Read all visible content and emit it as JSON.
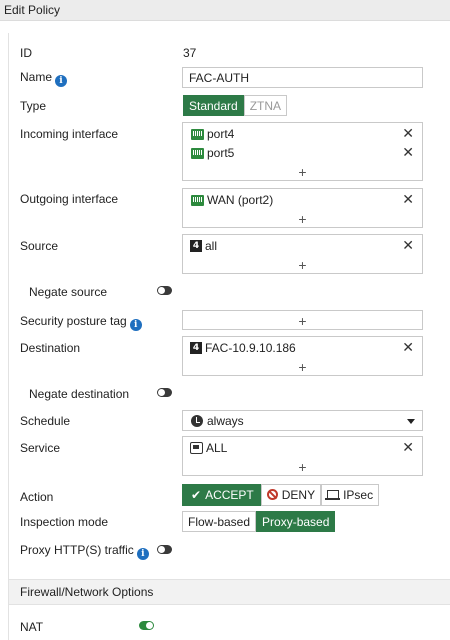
{
  "window": {
    "title": "Edit Policy"
  },
  "form": {
    "id": {
      "label": "ID",
      "value": "37"
    },
    "name": {
      "label": "Name",
      "value": "FAC-AUTH"
    },
    "type": {
      "label": "Type",
      "options": [
        "Standard",
        "ZTNA"
      ],
      "selected": "Standard"
    },
    "incoming_interface": {
      "label": "Incoming interface",
      "entries": [
        "port4",
        "port5"
      ]
    },
    "outgoing_interface": {
      "label": "Outgoing interface",
      "entries": [
        "WAN (port2)"
      ]
    },
    "source": {
      "label": "Source",
      "entries": [
        "all"
      ]
    },
    "negate_source": {
      "label": "Negate source",
      "enabled": false
    },
    "security_posture_tag": {
      "label": "Security posture tag"
    },
    "destination": {
      "label": "Destination",
      "entries": [
        "FAC-10.9.10.186"
      ]
    },
    "negate_destination": {
      "label": "Negate destination",
      "enabled": false
    },
    "schedule": {
      "label": "Schedule",
      "value": "always"
    },
    "service": {
      "label": "Service",
      "entries": [
        "ALL"
      ]
    },
    "action": {
      "label": "Action",
      "options": [
        "ACCEPT",
        "DENY",
        "IPsec"
      ],
      "selected": "ACCEPT"
    },
    "inspection_mode": {
      "label": "Inspection mode",
      "options": [
        "Flow-based",
        "Proxy-based"
      ],
      "selected": "Proxy-based"
    },
    "proxy_https_traffic": {
      "label": "Proxy HTTP(S) traffic",
      "enabled": false
    }
  },
  "firewall_section": {
    "title": "Firewall/Network Options",
    "nat": {
      "label": "NAT",
      "enabled": true
    }
  },
  "icons": {
    "info": "info-icon",
    "port": "port-icon",
    "address": "address-icon",
    "service": "service-icon",
    "schedule": "clock-icon",
    "remove": "close-icon",
    "add": "plus-icon"
  },
  "colors": {
    "accent": "#2d7a47",
    "info": "#1f6fbf",
    "deny": "#c0392b"
  }
}
